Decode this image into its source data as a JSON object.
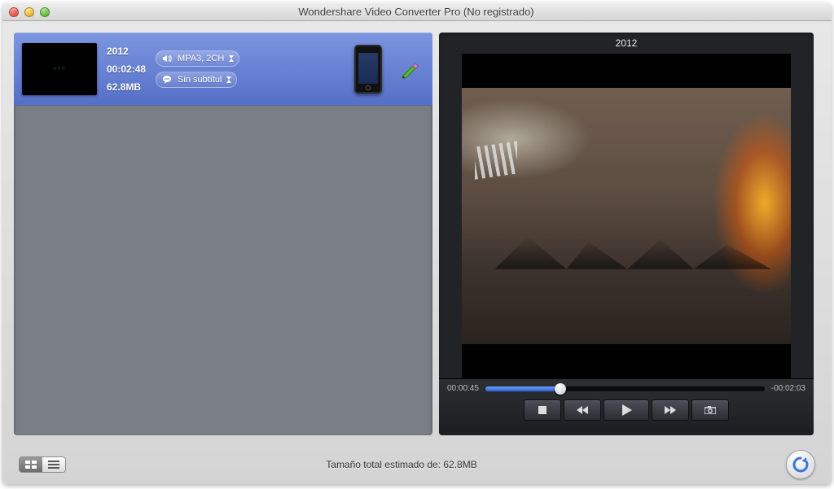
{
  "window": {
    "title": "Wondershare Video Converter Pro (No registrado)"
  },
  "queue": {
    "items": [
      {
        "title": "2012",
        "duration": "00:02:48",
        "size": "62.8MB",
        "audio": "MPA3, 2CH",
        "subtitle": "Sin subtítul",
        "target_device": "iPhone"
      }
    ]
  },
  "preview": {
    "title": "2012",
    "elapsed": "00:00:45",
    "remaining": "-00:02:03"
  },
  "footer": {
    "status_prefix": "Tamaño total estimado de: ",
    "total_size": "62.8MB"
  }
}
